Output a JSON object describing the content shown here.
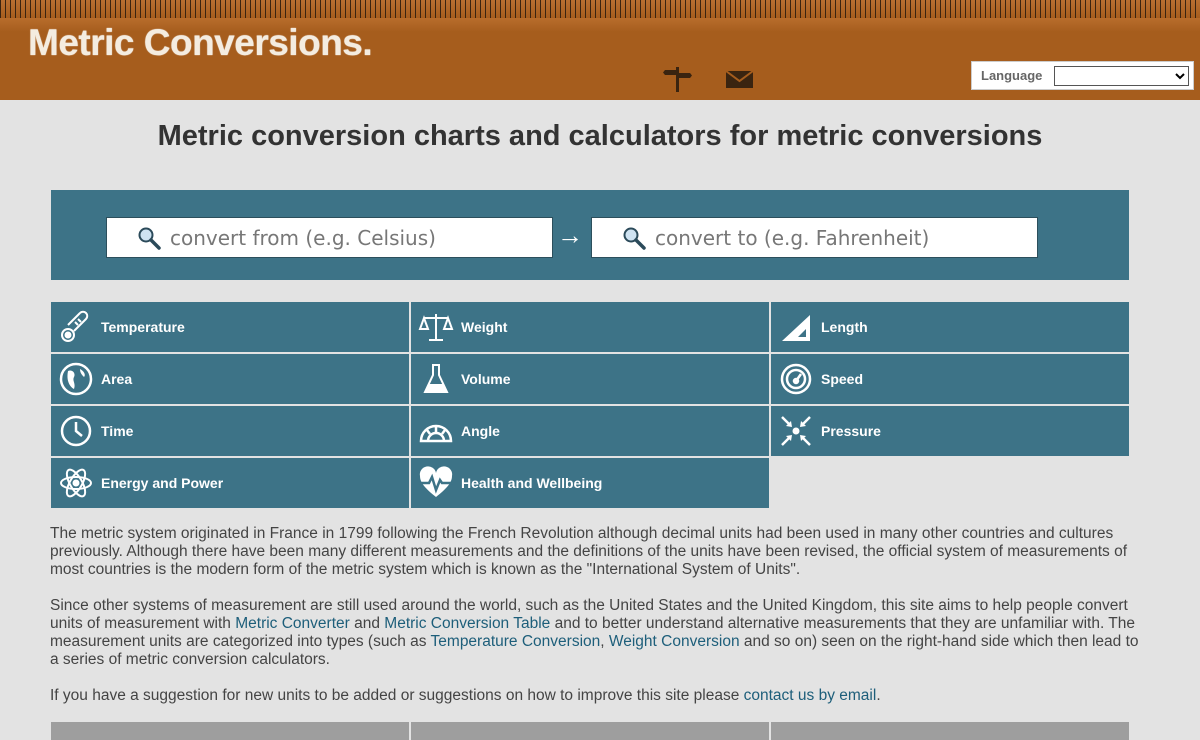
{
  "header": {
    "logo": "Metric Conversions.",
    "language_label": "Language",
    "language_value": ""
  },
  "page_title": "Metric conversion charts and calculators for metric conversions",
  "search": {
    "from_placeholder": "convert from (e.g. Celsius)",
    "to_placeholder": "convert to (e.g. Fahrenheit)",
    "arrow": "→"
  },
  "categories": [
    {
      "label": "Temperature",
      "icon": "thermometer-icon"
    },
    {
      "label": "Weight",
      "icon": "scales-icon"
    },
    {
      "label": "Length",
      "icon": "ruler-triangle-icon"
    },
    {
      "label": "Area",
      "icon": "globe-icon"
    },
    {
      "label": "Volume",
      "icon": "flask-icon"
    },
    {
      "label": "Speed",
      "icon": "speedometer-icon"
    },
    {
      "label": "Time",
      "icon": "clock-icon"
    },
    {
      "label": "Angle",
      "icon": "protractor-icon"
    },
    {
      "label": "Pressure",
      "icon": "arrows-inward-icon"
    },
    {
      "label": "Energy and Power",
      "icon": "atom-icon"
    },
    {
      "label": "Health and Wellbeing",
      "icon": "heartbeat-icon"
    }
  ],
  "content": {
    "p1": "The metric system originated in France in 1799 following the French Revolution although decimal units had been used in many other countries and cultures previously. Although there have been many different measurements and the definitions of the units have been revised, the official system of measurements of most countries is the modern form of the metric system which is known as the \"International System of Units\".",
    "p2_a": "Since other systems of measurement are still used around the world, such as the United States and the United Kingdom, this site aims to help people convert units of measurement with ",
    "p2_link1": "Metric Converter",
    "p2_b": " and ",
    "p2_link2": "Metric Conversion Table",
    "p2_c": " and to better understand alternative measurements that they are unfamiliar with. The measurement units are categorized into types (such as ",
    "p2_link3": "Temperature Conversion",
    "p2_d": ", ",
    "p2_link4": "Weight Conversion",
    "p2_e": " and so on) seen on the right-hand side which then lead to a series of metric conversion calculators.",
    "p3_a": "If you have a suggestion for new units to be added or suggestions on how to improve this site please ",
    "p3_link": "contact us by email",
    "p3_b": "."
  },
  "colors": {
    "header_brown": "#a65d1d",
    "tile_teal": "#3d7387",
    "link_blue": "#1d5e7a",
    "background": "#e3e3e3"
  }
}
